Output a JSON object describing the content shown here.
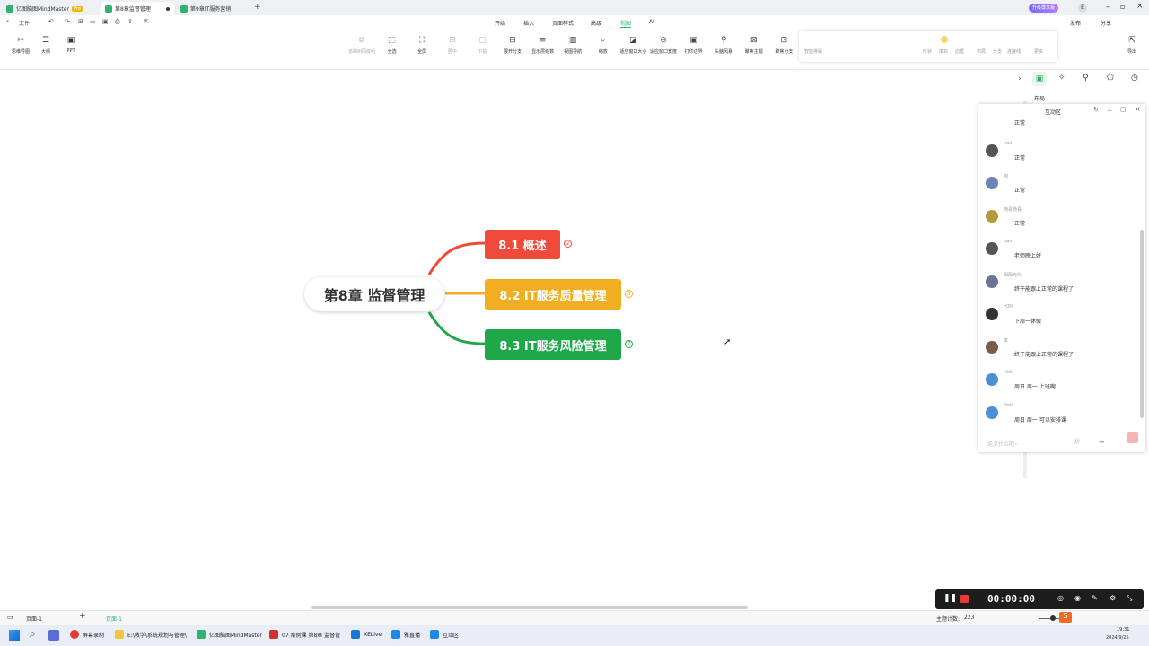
{
  "titlebar": {
    "tabs": [
      {
        "label": "亿图脑图MindMaster",
        "badge": "Pro"
      },
      {
        "label": "第8章监督管理"
      },
      {
        "label": "第9章IT服务营销"
      }
    ],
    "new_tab": "+",
    "member_badge": "升级尊享版",
    "user_initial": "E"
  },
  "quickbar": {
    "back": "‹",
    "file_label": "文件",
    "publish": "发布",
    "share": "分享"
  },
  "menu": {
    "items": [
      "开始",
      "插入",
      "页面样式",
      "高级",
      "视图",
      "AI"
    ],
    "active_index": 4
  },
  "left_modes": [
    {
      "label": "思维导图",
      "icon": "mindmap-icon"
    },
    {
      "label": "大纲",
      "icon": "outline-icon"
    },
    {
      "label": "PPT",
      "icon": "ppt-icon"
    }
  ],
  "view_tools": [
    {
      "label": "追踪树同级组",
      "dim": true,
      "icon": "⧉"
    },
    {
      "label": "全选",
      "icon": "⬚"
    },
    {
      "label": "全屏",
      "icon": "⛶"
    },
    {
      "label": "居中",
      "dim": true,
      "icon": "⊞"
    },
    {
      "label": "下钻",
      "dim": true,
      "icon": "▢"
    },
    {
      "label": "展开分支",
      "icon": "⊟"
    },
    {
      "label": "显示层级数",
      "icon": "≡"
    },
    {
      "label": "视图导航",
      "icon": "▥"
    },
    {
      "label": "缩放",
      "icon": "⌕"
    },
    {
      "label": "适应窗口大小",
      "icon": "◪"
    },
    {
      "label": "适应窗口宽度",
      "icon": "⊖"
    },
    {
      "label": "打印边界",
      "icon": "▣"
    },
    {
      "label": "头脑风暴",
      "icon": "⚲"
    },
    {
      "label": "聚焦主题",
      "icon": "⊠"
    },
    {
      "label": "聚焦分支",
      "icon": "⊡"
    }
  ],
  "format_tools": [
    "智能排版",
    "形状",
    "填充",
    "边框",
    "布局",
    "分支",
    "连接线",
    "更多"
  ],
  "export_label": "导出",
  "side_icons": [
    "布局"
  ],
  "mindmap": {
    "root": "第8章 监督管理",
    "branches": [
      {
        "label": "8.1 概述",
        "color": "#f04a3b",
        "count": "2"
      },
      {
        "label": "8.2 IT服务质量管理",
        "color": "#f2ae22",
        "count": "3"
      },
      {
        "label": "8.3 IT服务风险管理",
        "color": "#1fa84a",
        "count": "7"
      }
    ]
  },
  "chat": {
    "title": "互动区",
    "messages": [
      {
        "user": "",
        "text": "正常"
      },
      {
        "user": "pao",
        "text": "正常"
      },
      {
        "user": "何",
        "text": "正常"
      },
      {
        "user": "随喜随喜",
        "text": "正常"
      },
      {
        "user": "pao",
        "text": "老师晚上好"
      },
      {
        "user": "阳阳光怜",
        "text": "终于能跟上正常的课程了"
      },
      {
        "user": "H3M",
        "text": "下周一休假"
      },
      {
        "user": "未",
        "text": "终于能跟上正常的课程了"
      },
      {
        "user": "Halo",
        "text": "周日 周一 上班啊"
      },
      {
        "user": "Halo",
        "text": "周日 周一 可以安排课"
      }
    ],
    "input_placeholder": "说点什么吧~"
  },
  "recorder": {
    "time": "00:00:00"
  },
  "statusbar": {
    "page": "页面-1",
    "add": "+",
    "page_tab": "页面-1",
    "topic_count_label": "主题计数:",
    "topic_count": "223"
  },
  "taskbar": {
    "items": [
      "屏幕录制",
      "E:\\教学\\系统规划与管理\\",
      "亿图脑图MindMaster",
      "07 案例课 第8章 监督管",
      "XELive",
      "雅直播",
      "互动区"
    ],
    "time": "19:31",
    "date": "2024/9/25"
  }
}
